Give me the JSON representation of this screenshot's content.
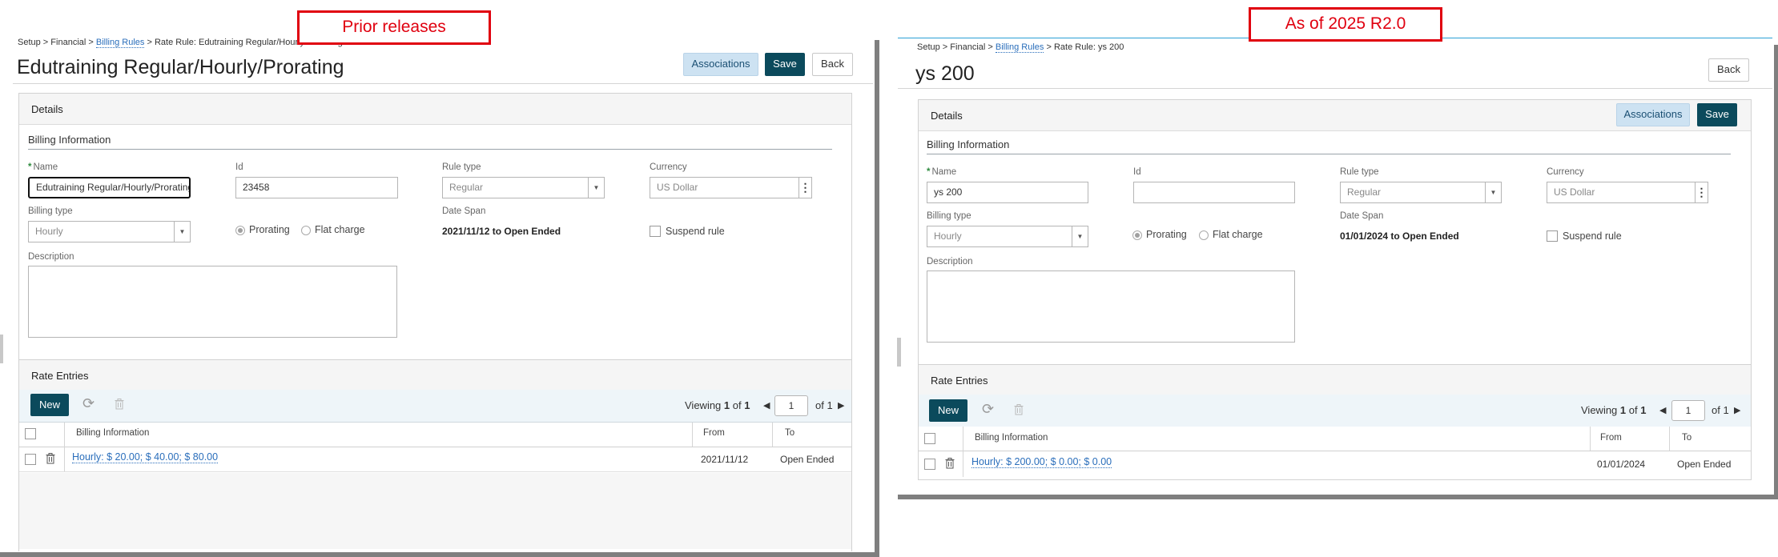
{
  "labels": {
    "prior": "Prior releases",
    "new": "As of 2025 R2.0"
  },
  "colors": {
    "accent": "#0b4a5c",
    "link": "#2a6ebb",
    "annotation": "#e0000f"
  },
  "left": {
    "breadcrumb": {
      "setup": "Setup",
      "financial": "Financial",
      "billing_rules": "Billing Rules",
      "current": "Rate Rule: Edutraining Regular/Hourly/Prorating"
    },
    "title": "Edutraining Regular/Hourly/Prorating",
    "buttons": {
      "associations": "Associations",
      "save": "Save",
      "back": "Back"
    },
    "details": {
      "header": "Details",
      "section": "Billing Information",
      "name_label": "Name",
      "name_value": "Edutraining Regular/Hourly/Prorating",
      "id_label": "Id",
      "id_value": "23458",
      "rule_type_label": "Rule type",
      "rule_type_value": "Regular",
      "currency_label": "Currency",
      "currency_value": "US Dollar",
      "billing_type_label": "Billing type",
      "billing_type_value": "Hourly",
      "prorating": "Prorating",
      "flat_charge": "Flat charge",
      "date_span_label": "Date Span",
      "date_span_value": "2021/11/12 to Open Ended",
      "suspend": "Suspend rule",
      "description_label": "Description"
    },
    "rates": {
      "header": "Rate Entries",
      "new": "New",
      "viewing": "Viewing",
      "page": "1",
      "of_word": "of",
      "total": "1",
      "page_input": "1",
      "of_total": "of 1",
      "columns": {
        "billing": "Billing Information",
        "from": "From",
        "to": "To"
      },
      "rows": [
        {
          "billing": "Hourly: $ 20.00; $ 40.00; $ 80.00",
          "from": "2021/11/12",
          "to": "Open Ended"
        }
      ]
    }
  },
  "right": {
    "breadcrumb": {
      "setup": "Setup",
      "financial": "Financial",
      "billing_rules": "Billing Rules",
      "current": "Rate Rule: ys 200"
    },
    "title": "ys 200",
    "buttons": {
      "associations": "Associations",
      "save": "Save",
      "back": "Back"
    },
    "details": {
      "header": "Details",
      "section": "Billing Information",
      "name_label": "Name",
      "name_value": "ys 200",
      "id_label": "Id",
      "id_value": "",
      "rule_type_label": "Rule type",
      "rule_type_value": "Regular",
      "currency_label": "Currency",
      "currency_value": "US Dollar",
      "billing_type_label": "Billing type",
      "billing_type_value": "Hourly",
      "prorating": "Prorating",
      "flat_charge": "Flat charge",
      "date_span_label": "Date Span",
      "date_span_value": "01/01/2024 to Open Ended",
      "suspend": "Suspend rule",
      "description_label": "Description"
    },
    "rates": {
      "header": "Rate Entries",
      "new": "New",
      "viewing": "Viewing",
      "page": "1",
      "of_word": "of",
      "total": "1",
      "page_input": "1",
      "of_total": "of 1",
      "columns": {
        "billing": "Billing Information",
        "from": "From",
        "to": "To"
      },
      "rows": [
        {
          "billing": "Hourly: $ 200.00; $ 0.00; $ 0.00",
          "from": "01/01/2024",
          "to": "Open Ended"
        }
      ]
    }
  }
}
